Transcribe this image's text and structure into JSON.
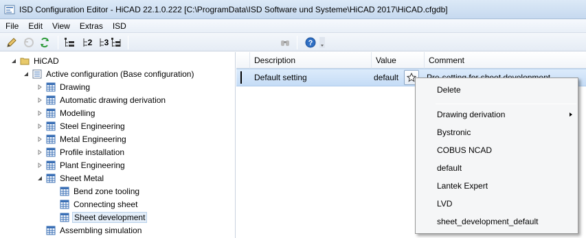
{
  "window": {
    "title": "ISD Configuration Editor - HiCAD 22.1.0.222 [C:\\ProgramData\\ISD Software und Systeme\\HiCAD 2017\\HiCAD.cfgdb]"
  },
  "menubar": {
    "items": [
      "File",
      "Edit",
      "View",
      "Extras",
      "ISD"
    ]
  },
  "toolbar": {
    "icons": [
      "edit-pencil-icon",
      "undo-icon",
      "refresh-icon",
      "tree-level-1-icon",
      "tree-level-2-icon",
      "tree-level-3-icon",
      "tree-all-levels-icon",
      "find-binoculars-icon",
      "help-icon",
      "toolbar-overflow-icon"
    ],
    "level2_label": "2",
    "level3_label": "3"
  },
  "tree": {
    "root": "HiCAD",
    "active_config": "Active configuration (Base configuration)",
    "children": [
      "Drawing",
      "Automatic drawing derivation",
      "Modelling",
      "Steel Engineering",
      "Metal Engineering",
      "Profile installation",
      "Plant Engineering",
      "Sheet Metal"
    ],
    "sheet_metal_children": [
      "Bend zone tooling",
      "Connecting sheet",
      "Sheet development"
    ],
    "after": "Assembling simulation",
    "selected": "Sheet development"
  },
  "grid": {
    "columns": [
      "Description",
      "Value",
      "Comment"
    ],
    "rows": [
      {
        "description": "Default setting",
        "value": "default",
        "comment": "Pre-setting for sheet development"
      }
    ]
  },
  "context_menu": {
    "delete": "Delete",
    "drawing_derivation": "Drawing derivation",
    "options": [
      "Bystronic",
      "COBUS NCAD",
      "default",
      "Lantek Expert",
      "LVD",
      "sheet_development_default"
    ]
  },
  "colors": {
    "selection_row": "#c5dcf6",
    "tree_icon_blue": "#3a6fb5"
  }
}
